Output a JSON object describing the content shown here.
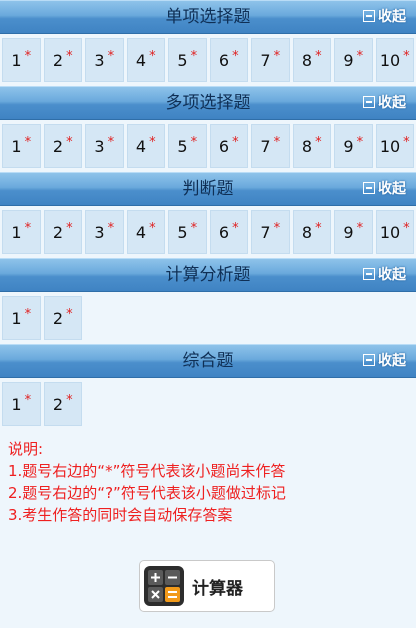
{
  "sections": [
    {
      "title": "单项选择题",
      "collapse": "收起",
      "questions": [
        {
          "num": "1",
          "mark": "*"
        },
        {
          "num": "2",
          "mark": "*"
        },
        {
          "num": "3",
          "mark": "*"
        },
        {
          "num": "4",
          "mark": "*"
        },
        {
          "num": "5",
          "mark": "*"
        },
        {
          "num": "6",
          "mark": "*"
        },
        {
          "num": "7",
          "mark": "*"
        },
        {
          "num": "8",
          "mark": "*"
        },
        {
          "num": "9",
          "mark": "*"
        },
        {
          "num": "10",
          "mark": "*"
        }
      ]
    },
    {
      "title": "多项选择题",
      "collapse": "收起",
      "questions": [
        {
          "num": "1",
          "mark": "*"
        },
        {
          "num": "2",
          "mark": "*"
        },
        {
          "num": "3",
          "mark": "*"
        },
        {
          "num": "4",
          "mark": "*"
        },
        {
          "num": "5",
          "mark": "*"
        },
        {
          "num": "6",
          "mark": "*"
        },
        {
          "num": "7",
          "mark": "*"
        },
        {
          "num": "8",
          "mark": "*"
        },
        {
          "num": "9",
          "mark": "*"
        },
        {
          "num": "10",
          "mark": "*"
        }
      ]
    },
    {
      "title": "判断题",
      "collapse": "收起",
      "questions": [
        {
          "num": "1",
          "mark": "*"
        },
        {
          "num": "2",
          "mark": "*"
        },
        {
          "num": "3",
          "mark": "*"
        },
        {
          "num": "4",
          "mark": "*"
        },
        {
          "num": "5",
          "mark": "*"
        },
        {
          "num": "6",
          "mark": "*"
        },
        {
          "num": "7",
          "mark": "*"
        },
        {
          "num": "8",
          "mark": "*"
        },
        {
          "num": "9",
          "mark": "*"
        },
        {
          "num": "10",
          "mark": "*"
        }
      ]
    },
    {
      "title": "计算分析题",
      "collapse": "收起",
      "questions": [
        {
          "num": "1",
          "mark": "*"
        },
        {
          "num": "2",
          "mark": "*"
        }
      ]
    },
    {
      "title": "综合题",
      "collapse": "收起",
      "questions": [
        {
          "num": "1",
          "mark": "*"
        },
        {
          "num": "2",
          "mark": "*"
        }
      ]
    }
  ],
  "notes": {
    "heading": "说明:",
    "line1": "1.题号右边的“*”符号代表该小题尚未作答",
    "line2": "2.题号右边的“?”符号代表该小题做过标记",
    "line3": "3.考生作答的同时会自动保存答案"
  },
  "calculator": {
    "label": "计算器"
  },
  "colors": {
    "header": "#4b8fcc",
    "cell": "#d5e7f5",
    "mark": "#e02020",
    "background": "#eef6fc"
  }
}
